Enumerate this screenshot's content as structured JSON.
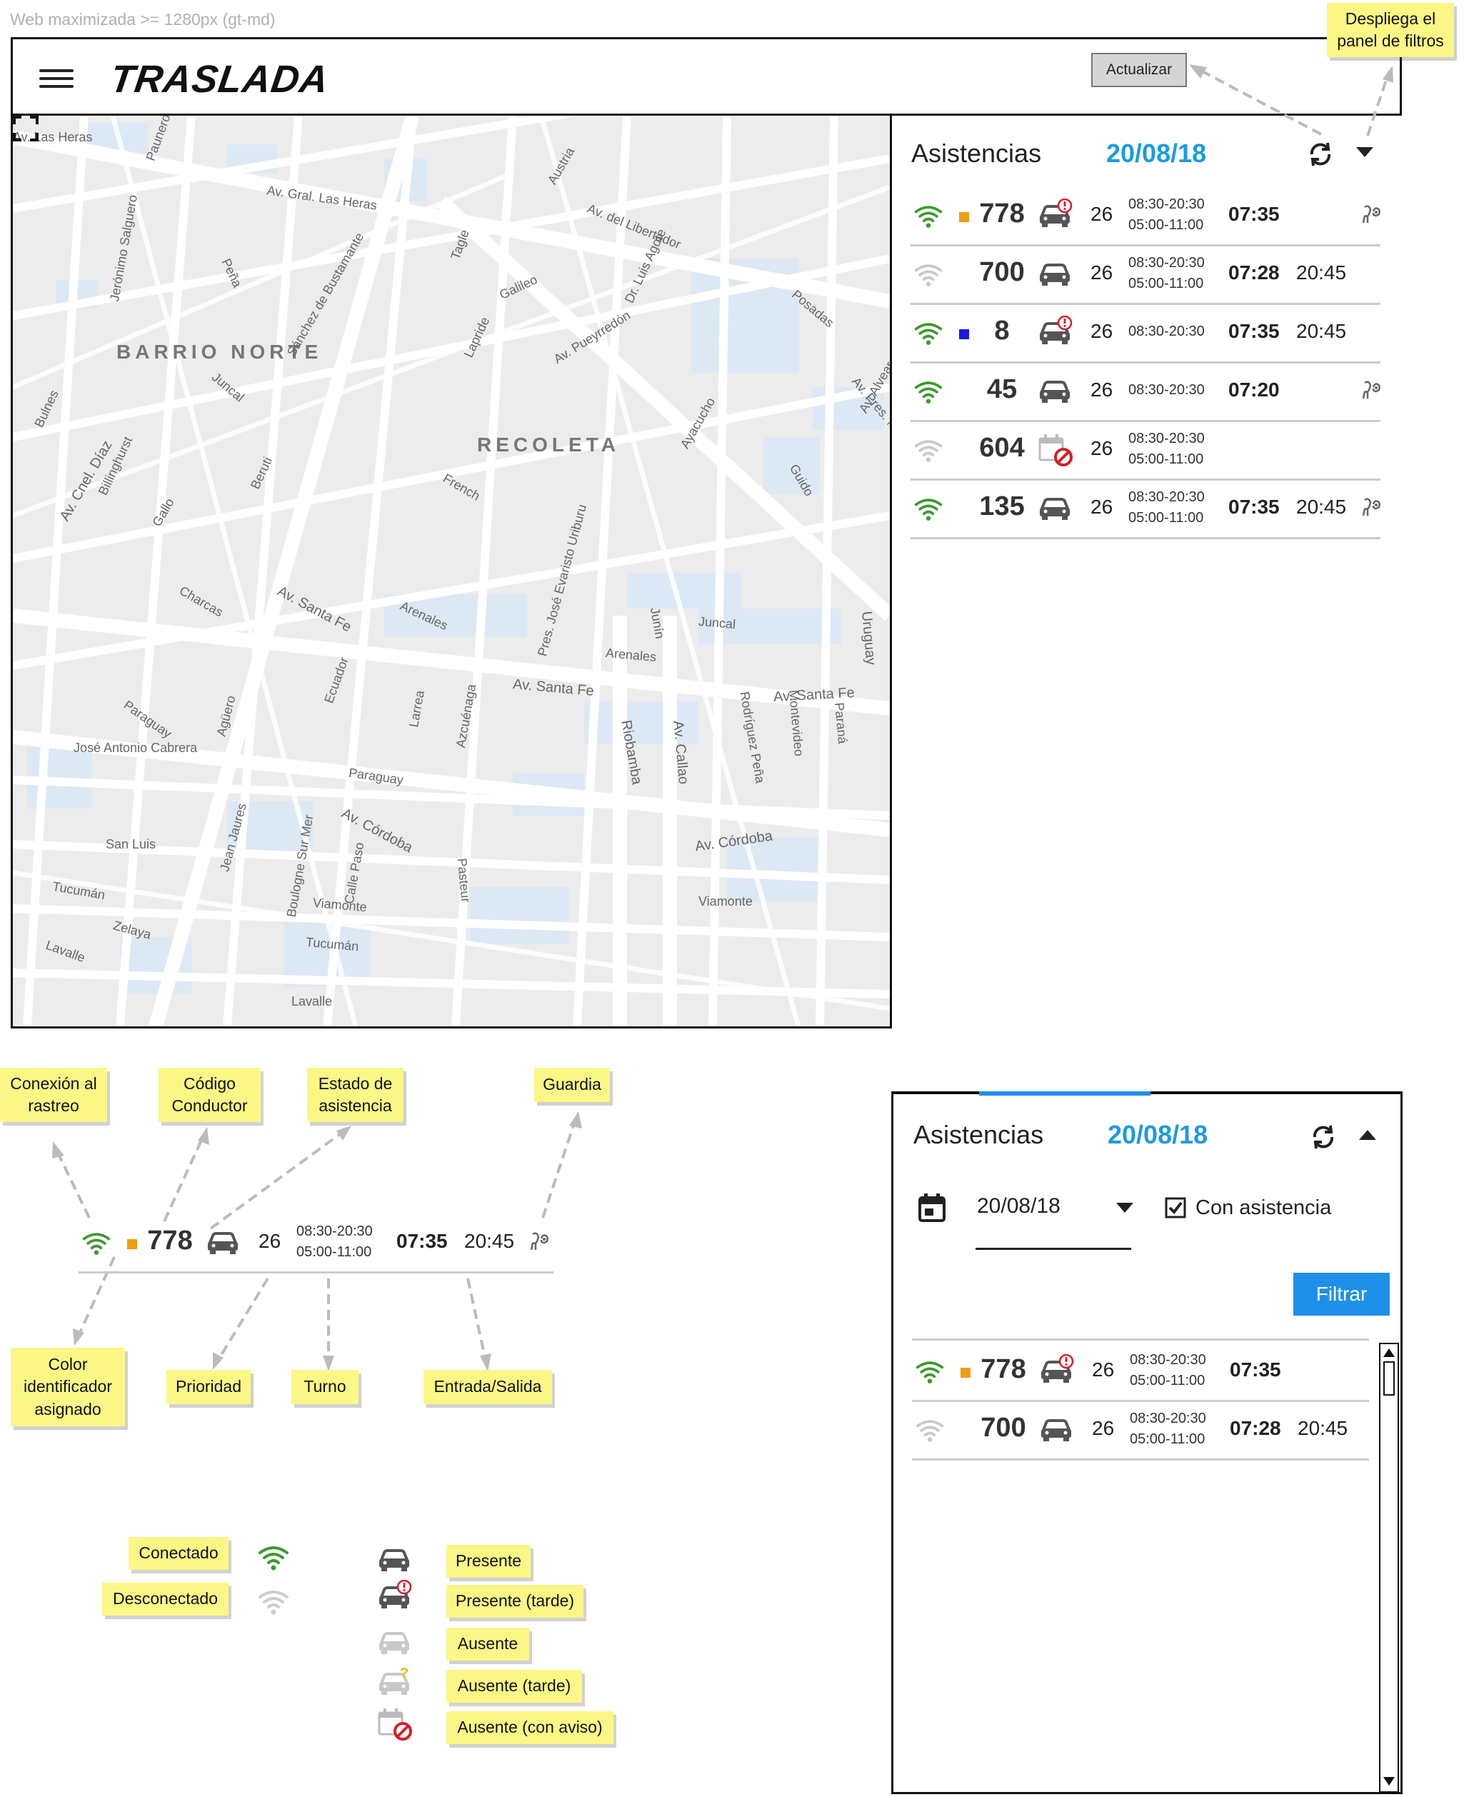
{
  "caption": "Web maximizada >= 1280px (gt-md)",
  "header": {
    "logo": "TRASLADA",
    "update_button": "Actualizar"
  },
  "map": {
    "districts": [
      "BARRIO NORTE",
      "RECOLETA"
    ],
    "streets": [
      "Av. Gral. Las Heras",
      "Av. del Libertador",
      "Austria",
      "Av. Pueyrredón",
      "Av. Santa Fe",
      "Juncal",
      "Arenales",
      "Av. Córdoba",
      "Riobamba",
      "Av. Callao",
      "Paraguay",
      "Tucumán",
      "Viamonte",
      "Lavalle",
      "Uruguay",
      "Charcas",
      "Beruti",
      "French",
      "Peña",
      "Ayacucho",
      "Junín",
      "Guido",
      "Posadas",
      "Azcuénaga",
      "Larrea",
      "Ecuador",
      "José Antonio Cabrera",
      "Gallo",
      "San Luis",
      "Zelaya",
      "Billinghurst",
      "Av. Cnel. Díaz",
      "Bulnes",
      "Sánchez de Bustamante",
      "Jerónimo Salguero",
      "Pres. José Evaristo Uriburu",
      "Rodríguez Peña",
      "Montevideo",
      "Paraná",
      "Av. Alvear",
      "Av. Pres. Manuel Quintana",
      "Tagle",
      "Galileo",
      "Agüero",
      "Jean Jaures",
      "Boulogne Sur Mer",
      "Calle Paso",
      "Pasteur",
      "Dr. Luis Agote",
      "Lapride",
      "Av. Cnel. Díaz",
      "Paunero",
      "Av. Las Heras"
    ]
  },
  "panel": {
    "title": "Asistencias",
    "date": "20/08/18",
    "rows": [
      {
        "connected": true,
        "color": "#f39c12",
        "code": "778",
        "status": "present-late",
        "priority": "26",
        "shift1": "08:30-20:30",
        "shift2": "05:00-11:00",
        "in": "07:35",
        "out": "",
        "guard": true
      },
      {
        "connected": false,
        "color": "",
        "code": "700",
        "status": "present",
        "priority": "26",
        "shift1": "08:30-20:30",
        "shift2": "05:00-11:00",
        "in": "07:28",
        "out": "20:45",
        "guard": false
      },
      {
        "connected": true,
        "color": "#1a1ae6",
        "code": "8",
        "status": "present-late",
        "priority": "26",
        "shift1": "08:30-20:30",
        "shift2": "",
        "in": "07:35",
        "out": "20:45",
        "guard": false
      },
      {
        "connected": true,
        "color": "",
        "code": "45",
        "status": "present",
        "priority": "26",
        "shift1": "08:30-20:30",
        "shift2": "",
        "in": "07:20",
        "out": "",
        "guard": true
      },
      {
        "connected": false,
        "color": "",
        "code": "604",
        "status": "absent-notice",
        "priority": "26",
        "shift1": "08:30-20:30",
        "shift2": "05:00-11:00",
        "in": "",
        "out": "",
        "guard": false
      },
      {
        "connected": true,
        "color": "",
        "code": "135",
        "status": "present",
        "priority": "26",
        "shift1": "08:30-20:30",
        "shift2": "05:00-11:00",
        "in": "07:35",
        "out": "20:45",
        "guard": true
      }
    ]
  },
  "notes": {
    "filter_panel": "Despliega el panel de filtros",
    "connection": "Conexión al rastreo",
    "driver_code": "Código Conductor",
    "assistance_state": "Estado de asistencia",
    "guard": "Guardia",
    "color_id": "Color identificador asignado",
    "priority": "Prioridad",
    "shift": "Turno",
    "entry_exit": "Entrada/Salida",
    "connected": "Conectado",
    "disconnected": "Desconectado",
    "present": "Presente",
    "present_late": "Presente (tarde)",
    "absent": "Ausente",
    "absent_late": "Ausente (tarde)",
    "absent_notice": "Ausente (con aviso)"
  },
  "legend_row": {
    "code": "778",
    "priority": "26",
    "shift1": "08:30-20:30",
    "shift2": "05:00-11:00",
    "in": "07:35",
    "out": "20:45"
  },
  "filter_panel": {
    "title": "Asistencias",
    "date": "20/08/18",
    "date_field": "20/08/18",
    "checkbox_label": "Con asistencia",
    "filter_button": "Filtrar",
    "rows": [
      {
        "code": "778",
        "priority": "26",
        "shift1": "08:30-20:30",
        "shift2": "05:00-11:00",
        "in": "07:35",
        "out": ""
      },
      {
        "code": "700",
        "priority": "26",
        "shift1": "08:30-20:30",
        "shift2": "05:00-11:00",
        "in": "07:28",
        "out": "20:45"
      }
    ]
  },
  "colors": {
    "accent": "#1e9ae0",
    "connected": "#3a9a2a",
    "disconnected": "#c8c8c8",
    "note": "#fbf786",
    "alert": "#d0202a"
  }
}
